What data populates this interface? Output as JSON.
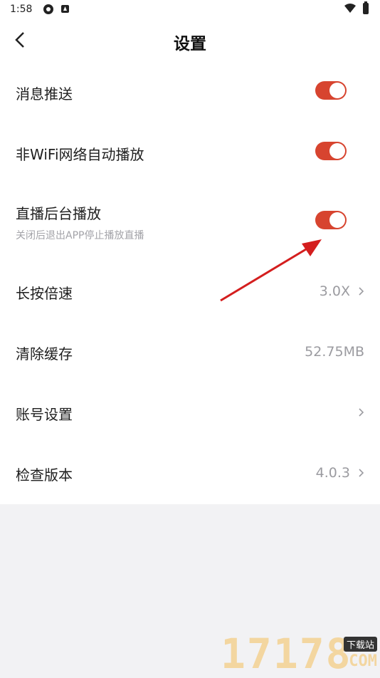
{
  "status_bar": {
    "time": "1:58"
  },
  "nav": {
    "title": "设置"
  },
  "settings": {
    "push": {
      "label": "消息推送",
      "enabled": true
    },
    "wifi_autoplay": {
      "label": "非WiFi网络自动播放",
      "enabled": true
    },
    "live_background": {
      "label": "直播后台播放",
      "sub": "关闭后退出APP停止播放直播",
      "enabled": true
    },
    "long_press_speed": {
      "label": "长按倍速",
      "value": "3.0X"
    },
    "clear_cache": {
      "label": "清除缓存",
      "value": "52.75MB"
    },
    "account": {
      "label": "账号设置"
    },
    "check_version": {
      "label": "检查版本",
      "value": "4.0.3"
    }
  },
  "watermark": {
    "number": "17178",
    "tag": "下载站",
    "domain": ".COM"
  },
  "colors": {
    "toggle_on": "#d7442f",
    "arrow": "#d41e1e",
    "bottom_bg": "#f2f2f4"
  }
}
